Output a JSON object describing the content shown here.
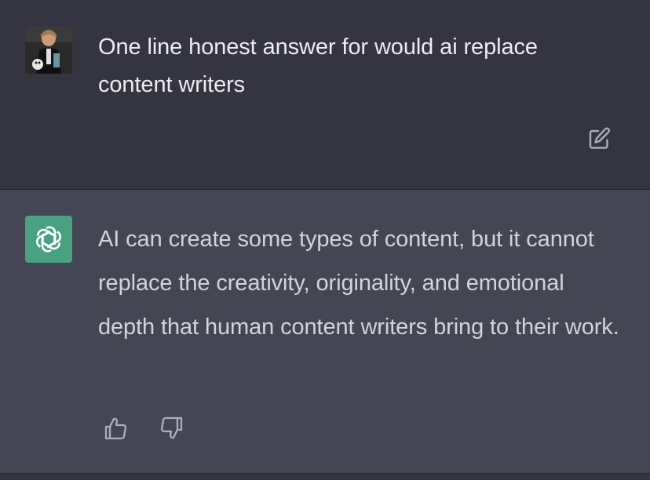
{
  "conversation": {
    "user_message": {
      "text": "One line honest answer for would ai replace content writers",
      "avatar_icon": "user-photo-avatar",
      "edit_icon": "edit-icon"
    },
    "assistant_message": {
      "text": "AI can create some types of content, but it cannot replace the creativity, originality, and emotional depth that human content writers bring to their work.",
      "avatar_icon": "openai-logo-icon",
      "feedback": {
        "thumbs_up_icon": "thumbs-up-icon",
        "thumbs_down_icon": "thumbs-down-icon"
      }
    }
  },
  "colors": {
    "user_bg": "#343541",
    "assistant_bg": "#444654",
    "logo_bg": "#4aa181",
    "text_primary": "#ececf1",
    "text_secondary": "#d1d5db",
    "icon": "#acacbe"
  }
}
